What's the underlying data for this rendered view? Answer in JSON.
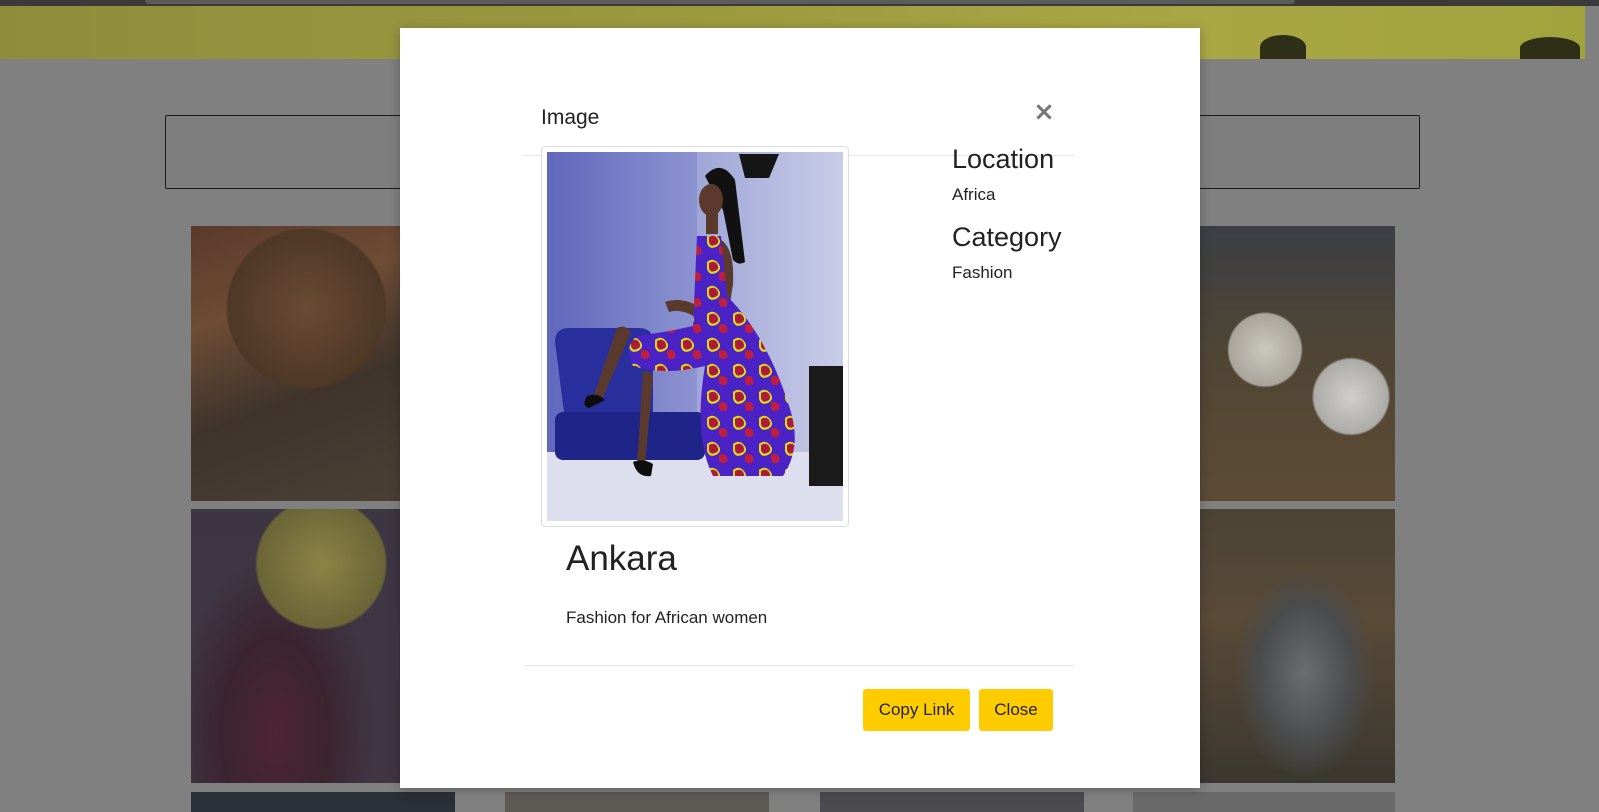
{
  "modal": {
    "title": "Image",
    "close_icon": "close-icon",
    "image": {
      "title": "Ankara",
      "description": "Fashion for African women"
    },
    "location": {
      "heading": "Location",
      "value": "Africa"
    },
    "category": {
      "heading": "Category",
      "value": "Fashion"
    },
    "buttons": {
      "copy_link": "Copy Link",
      "close": "Close"
    },
    "colors": {
      "button": "#ffcc00",
      "backdrop": "#808080"
    }
  }
}
